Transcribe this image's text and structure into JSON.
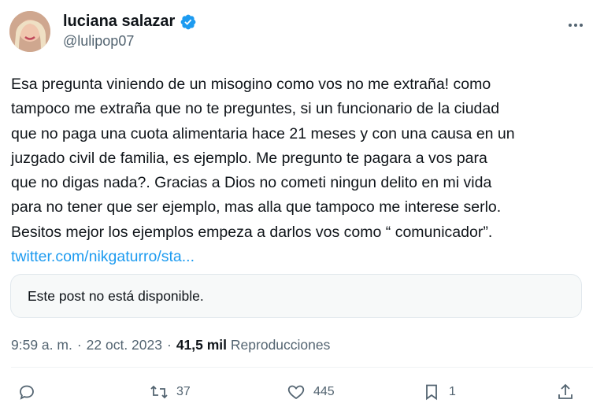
{
  "author": {
    "display_name": "luciana salazar",
    "handle": "@lulipop07",
    "verified": true
  },
  "post": {
    "text_lines": [
      "Esa pregunta viniendo de un misogino como vos no me extraña! como",
      "tampoco me extraña que no te preguntes, si un funcionario de la ciudad",
      "que no paga una cuota alimentaria hace 21 meses y con una causa en un",
      "juzgado civil de familia, es ejemplo. Me pregunto te pagara a vos para",
      "que no digas nada?. Gracias a Dios no cometi ningun delito en mi vida",
      "para no tener que ser ejemplo, mas alla que tampoco me interese serlo.",
      "Besitos mejor los ejemplos empeza a darlos vos como “ comunicador”."
    ],
    "link": "twitter.com/nikgaturro/sta..."
  },
  "quoted": {
    "unavailable_text": "Este post no está disponible."
  },
  "meta": {
    "time": "9:59 a. m.",
    "separator1": "·",
    "date": "22 oct. 2023",
    "separator2": "·",
    "views_count": "41,5 mil",
    "views_label": "Reproducciones"
  },
  "actions": {
    "reply_count": "",
    "retweet_count": "37",
    "like_count": "445",
    "bookmark_count": "1"
  },
  "icons": {
    "verified": "verified-badge-icon",
    "more": "more-icon",
    "reply": "reply-icon",
    "retweet": "retweet-icon",
    "like": "heart-icon",
    "bookmark": "bookmark-icon",
    "share": "share-icon"
  },
  "colors": {
    "link": "#1d9bf0",
    "secondary_text": "#536471",
    "primary_text": "#0f1419"
  }
}
